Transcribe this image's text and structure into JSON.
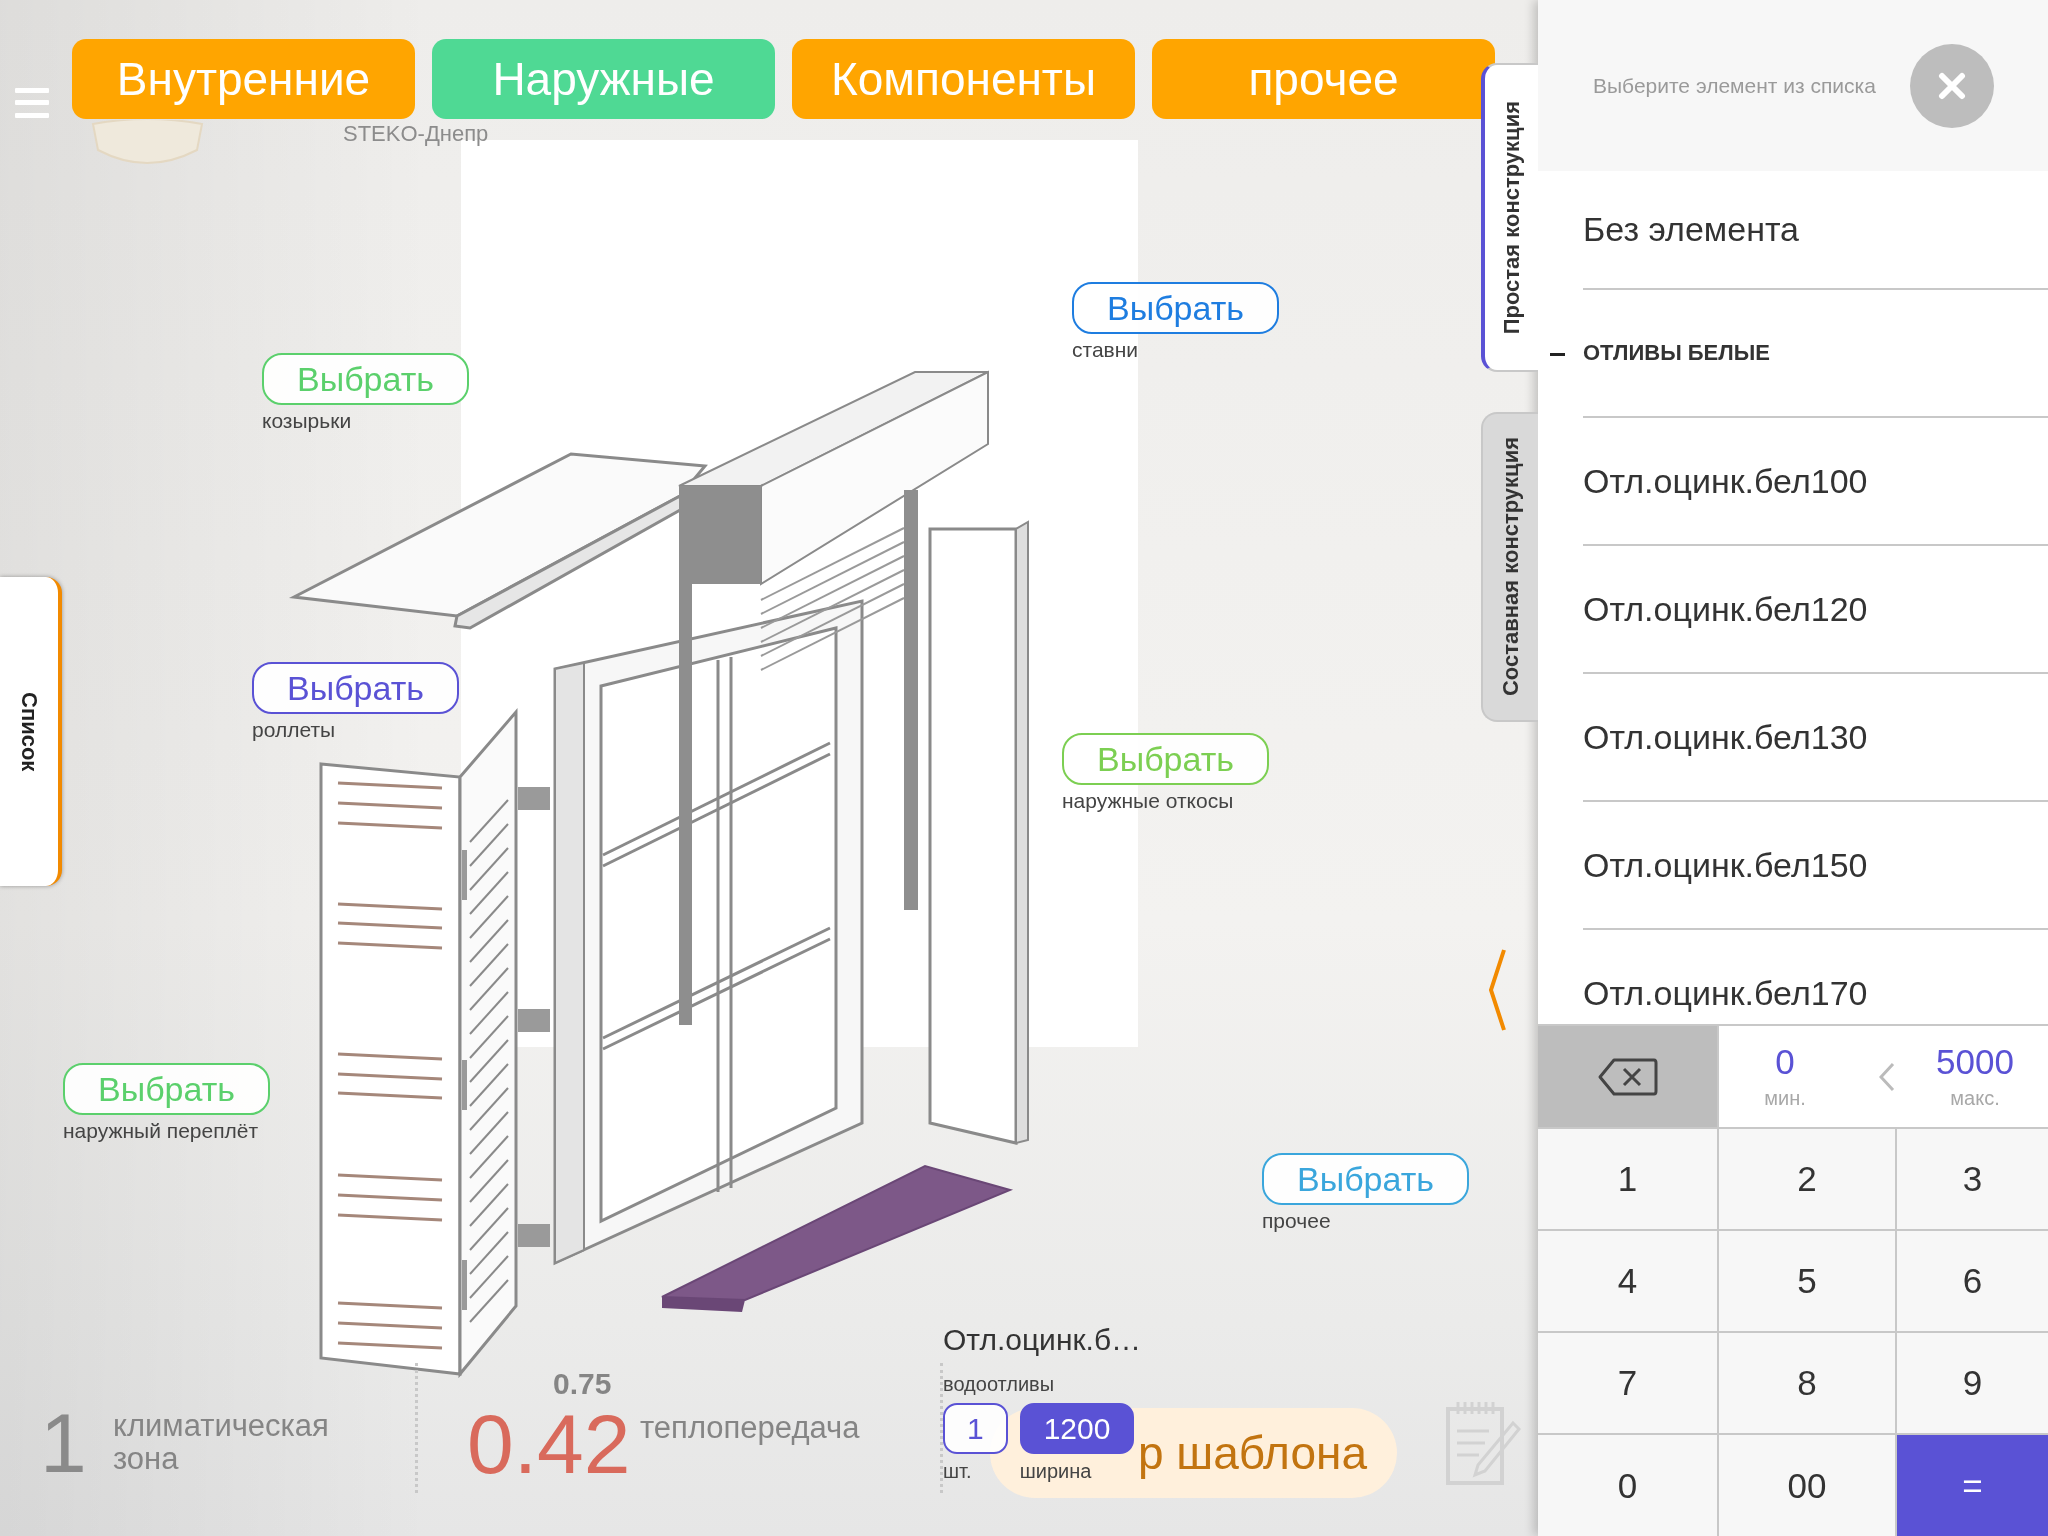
{
  "brand": "STEKO-Днепр",
  "tabs": [
    {
      "label": "Внутренние",
      "selected": false
    },
    {
      "label": "Наружные",
      "selected": true
    },
    {
      "label": "Компоненты",
      "selected": false
    },
    {
      "label": "прочее",
      "selected": false
    }
  ],
  "callouts": [
    {
      "button": "Выбрать",
      "label": "ставни",
      "color": "#1e7de0"
    },
    {
      "button": "Выбрать",
      "label": "козырьки",
      "color": "#5bd06c"
    },
    {
      "button": "Выбрать",
      "label": "роллеты",
      "color": "#5a52d5"
    },
    {
      "button": "Выбрать",
      "label": "наружные откосы",
      "color": "#7ccf52"
    },
    {
      "button": "Выбрать",
      "label": "наружный переплёт",
      "color": "#5bd06c"
    },
    {
      "button": "Выбрать",
      "label": "прочее",
      "color": "#3aa6dc"
    }
  ],
  "list_tab": {
    "label": "Список"
  },
  "selection": {
    "title": "Отл.оцинк.б…",
    "category": "водоотливы",
    "fields": [
      {
        "value": "1",
        "label": "шт.",
        "selected": false
      },
      {
        "value": "1200",
        "label": "ширина",
        "selected": true
      }
    ]
  },
  "summary": {
    "zone_value": "1",
    "zone_label": "климатическая зона",
    "reference": "0.75",
    "heat_value": "0.42",
    "heat_label": "теплопередача",
    "template_button": "р шаблона"
  },
  "panel_tabs": [
    {
      "label": "Простая конструкция",
      "selected": true
    },
    {
      "label": "Составная конструкция",
      "selected": false
    }
  ],
  "panel": {
    "prompt": "Выберите элемент из списка",
    "items": [
      {
        "kind": "option",
        "label": "Без элемента"
      },
      {
        "kind": "group",
        "label": "ОТЛИВЫ БЕЛЫЕ",
        "expanded": true,
        "children": [
          {
            "kind": "option",
            "label": "Отл.оцинк.бел100"
          },
          {
            "kind": "option",
            "label": "Отл.оцинк.бел120"
          },
          {
            "kind": "option",
            "label": "Отл.оцинк.бел130"
          },
          {
            "kind": "option",
            "label": "Отл.оцинк.бел150"
          },
          {
            "kind": "option",
            "label": "Отл.оцинк.бел170"
          }
        ]
      }
    ]
  },
  "keypad": {
    "min": "0",
    "min_label": "мин.",
    "max": "5000",
    "max_label": "макс.",
    "keys": [
      {
        "kind": "digit",
        "label": "1"
      },
      {
        "kind": "digit",
        "label": "2"
      },
      {
        "kind": "digit",
        "label": "3"
      },
      {
        "kind": "digit",
        "label": "4"
      },
      {
        "kind": "digit",
        "label": "5"
      },
      {
        "kind": "digit",
        "label": "6"
      },
      {
        "kind": "digit",
        "label": "7"
      },
      {
        "kind": "digit",
        "label": "8"
      },
      {
        "kind": "digit",
        "label": "9"
      },
      {
        "kind": "digit",
        "label": "0"
      },
      {
        "kind": "digit",
        "label": "00"
      },
      {
        "kind": "equals",
        "label": "="
      }
    ]
  }
}
